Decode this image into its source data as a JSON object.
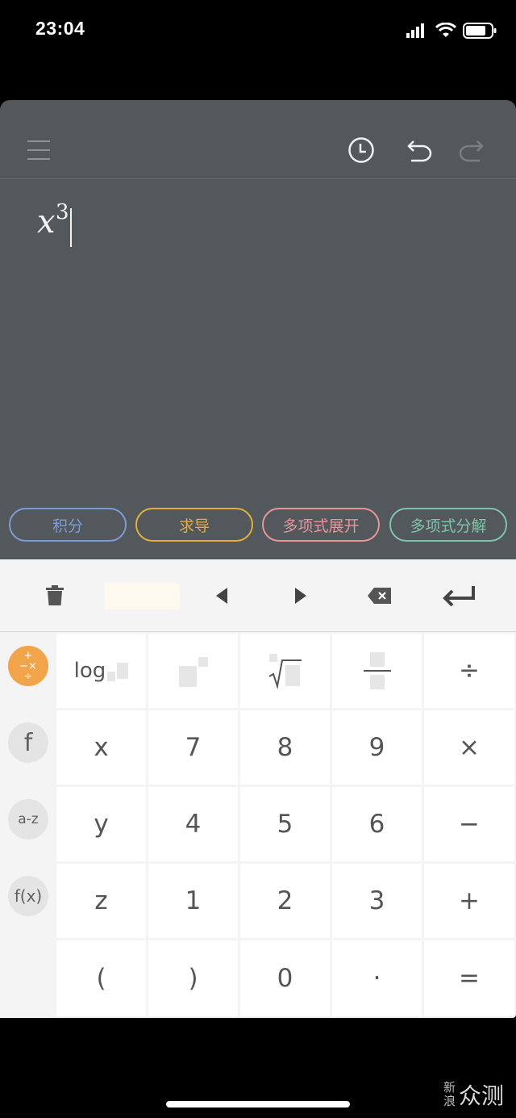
{
  "status_bar": {
    "time": "23:04"
  },
  "toolbar": {
    "menu_icon": "menu-icon",
    "history_icon": "clock-icon",
    "undo_icon": "undo-icon",
    "redo_icon": "redo-icon"
  },
  "expression": {
    "variable": "x",
    "exponent": "3"
  },
  "chips": [
    {
      "label": "积分",
      "color": "#7e9bd4"
    },
    {
      "label": "求导",
      "color": "#e3ad3f"
    },
    {
      "label": "多项式展开",
      "color": "#e79599"
    },
    {
      "label": "多项式分解",
      "color": "#7fc3a8"
    }
  ],
  "keyboard_toolbar": {
    "trash_icon": "trash-icon",
    "left_icon": "arrow-left-icon",
    "right_icon": "arrow-right-icon",
    "backspace_icon": "backspace-icon",
    "enter_icon": "enter-icon"
  },
  "side_buttons": [
    {
      "label": "+−×÷",
      "active_color": "#f2a44a"
    },
    {
      "label": "f"
    },
    {
      "label": "a-z"
    },
    {
      "label": "f(x)"
    }
  ],
  "keys": {
    "row0": [
      "log",
      "",
      "",
      "",
      "÷"
    ],
    "row1": [
      "x",
      "7",
      "8",
      "9",
      "×"
    ],
    "row2": [
      "y",
      "4",
      "5",
      "6",
      "−"
    ],
    "row3": [
      "z",
      "1",
      "2",
      "3",
      "+"
    ],
    "row4": [
      "(",
      ")",
      "0",
      "·",
      "="
    ]
  },
  "watermark": {
    "small_top": "新",
    "small_bottom": "浪",
    "big": "众测"
  }
}
